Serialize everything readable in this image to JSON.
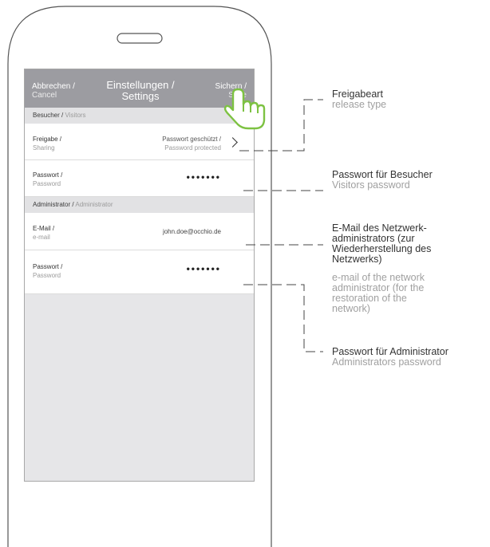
{
  "nav": {
    "cancel_de": "Abbrechen /",
    "cancel_en": "Cancel",
    "title_de": "Einstellungen /",
    "title_en": "Settings",
    "save_de": "Sichern /",
    "save_en": "Save"
  },
  "visitors_section": {
    "de": "Besucher /",
    "en": " Visitors"
  },
  "sharing_row": {
    "label_de": "Freigabe /",
    "label_en": "Sharing",
    "value_de": "Passwort geschützt /",
    "value_en": "Password protected"
  },
  "visitor_password_row": {
    "label_de": "Passwort /",
    "label_en": "Password",
    "value": "•••••••"
  },
  "admin_section": {
    "de": "Administrator /",
    "en": " Administrator"
  },
  "email_row": {
    "label_de": "E-Mail /",
    "label_en": "e-mail",
    "value": "john.doe@occhio.de"
  },
  "admin_password_row": {
    "label_de": "Passwort /",
    "label_en": "Password",
    "value": "•••••••"
  },
  "annotations": {
    "release_type": {
      "de": "Freigabeart",
      "en": "release type"
    },
    "visitors_password": {
      "de": "Passwort für Besucher",
      "en": "Visitors password"
    },
    "email": {
      "de": "E-Mail des Netzwerk-\nadministrators (zur\nWiederherstellung des\nNetzwerks)",
      "en": "e-mail of the network\nadministrator (for the\nrestoration of the\nnetwork)"
    },
    "admin_password": {
      "de": "Passwort für Administrator",
      "en": "Administrators password"
    }
  },
  "colors": {
    "nav_bar": "#9c9ca1",
    "hand_accent": "#7dc242",
    "section_bg": "#e2e2e4"
  },
  "icons": [
    "chevron-right-icon",
    "pointing-hand-icon"
  ]
}
